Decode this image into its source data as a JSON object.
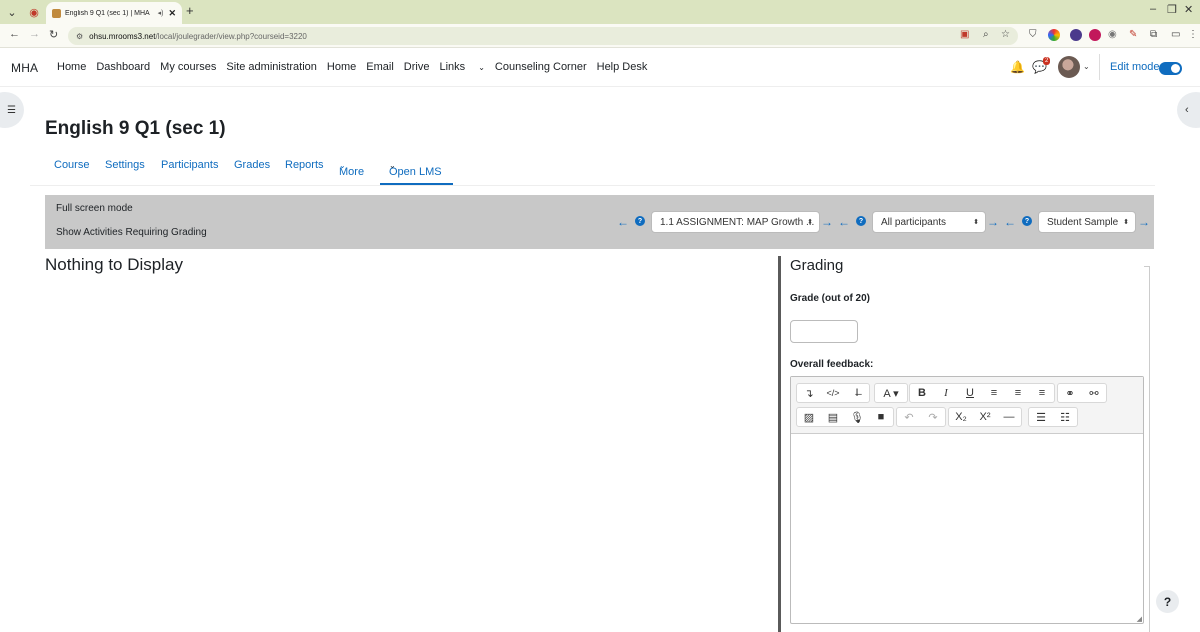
{
  "browser": {
    "tab_title": "English 9 Q1 (sec 1) | MHA",
    "tab_audio_icon": "speaker-icon",
    "tab_close": "✕",
    "new_tab": "+",
    "url_host": "ohsu.mrooms3.net",
    "url_path": "/local/joulegrader/view.php?courseid=3220"
  },
  "navbar": {
    "brand": "MHA",
    "links": [
      "Home",
      "Dashboard",
      "My courses",
      "Site administration",
      "Home",
      "Email",
      "Drive",
      "Links",
      "Counseling Corner",
      "Help Desk"
    ],
    "links_caret": "⌄",
    "message_badge": "2",
    "edit_mode_label": "Edit mode",
    "edit_mode_on": true
  },
  "course": {
    "title": "English 9 Q1 (sec 1)"
  },
  "secondary_nav": {
    "items": [
      "Course",
      "Settings",
      "Participants",
      "Grades",
      "Reports",
      "More",
      "Open LMS"
    ],
    "active": "Open LMS"
  },
  "grader_bar": {
    "full_screen": "Full screen mode",
    "show_activities": "Show Activities Requiring Grading",
    "activity_select": "1.1 ASSIGNMENT: MAP Growth ...",
    "group_select": "All participants",
    "user_select": "Student Sample"
  },
  "main": {
    "empty_message": "Nothing to Display"
  },
  "grading": {
    "heading": "Grading",
    "grade_label": "Grade (out of 20)",
    "grade_value": "",
    "feedback_label": "Overall feedback:"
  },
  "help_button": "?",
  "colors": {
    "accent": "#0f6cbf",
    "tabbar": "#dbe4c0",
    "graybar": "#c8c8c8"
  }
}
